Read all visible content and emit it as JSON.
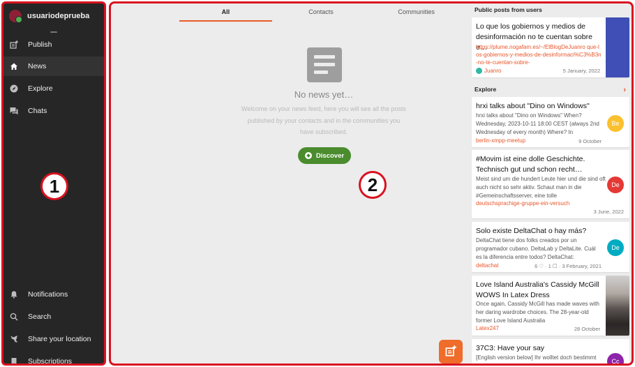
{
  "sidebar": {
    "username": "usuariodeprueba",
    "items": [
      {
        "label": "Publish",
        "icon": "publish-icon"
      },
      {
        "label": "News",
        "icon": "home-icon"
      },
      {
        "label": "Explore",
        "icon": "compass-icon"
      },
      {
        "label": "Chats",
        "icon": "chat-icon"
      }
    ],
    "bottom": [
      {
        "label": "Notifications",
        "icon": "bell-icon"
      },
      {
        "label": "Search",
        "icon": "search-icon"
      },
      {
        "label": "Share your location",
        "icon": "location-off-icon"
      },
      {
        "label": "Subscriptions",
        "icon": "bookmark-icon"
      }
    ]
  },
  "markers": {
    "one": "1",
    "two": "2"
  },
  "feed": {
    "tabs": [
      "All",
      "Contacts",
      "Communities"
    ],
    "empty_title": "No news yet…",
    "empty_body": "Welcome on your news feed, here you will see all the posts published by your contacts and in the communities you have subscribed.",
    "discover_label": "Discover"
  },
  "public_posts": {
    "title": "Public posts from users",
    "card": {
      "title": "Lo que los gobiernos y medios de desinformación no te cuentan sobre e…",
      "link": "https://plume.nogafam.es/~/ElBlogDeJuanro que-los-gobiernos-y-medios-de-desinformaci%C3%B3n-no-te-cuentan-sobre-",
      "author": "Juanro",
      "date": "5 January, 2022"
    }
  },
  "explore": {
    "title": "Explore",
    "cards": [
      {
        "title": "hrxi talks about \"Dino on Windows\"",
        "body": "hrxi talks about \"Dino on Windows\" When? Wednesday, 2023-10-11 18:00 CEST (always 2nd Wednesday of every month) Where? In",
        "link": "berlin-xmpp-meetup",
        "meta": "9 October",
        "badge": "Be",
        "badge_color": "#fbc02d"
      },
      {
        "title": "#Movim ist eine dolle Geschichte. Technisch gut und schon recht…",
        "body": "Meist sind um die hundert Leute hier und die sind oft auch nicht so sehr aktiv. Schaut man in die #Gemeinschaftsserver, eine tolle",
        "link": "deutschsprachige-gruppe-ein-versuch",
        "meta": "3 June, 2022",
        "badge": "De",
        "badge_color": "#e53935"
      },
      {
        "title": "Solo existe DeltaChat o hay más?",
        "body": "DeltaChat tiene dos folks creados por un programador cubano. DeltaLab y DeltaLite. Cuál es la diferencia entre todos? DeltaChat:",
        "link": "deltachat",
        "meta": "6 ♡ · 1 ☐ · 3 February, 2021",
        "badge": "De",
        "badge_color": "#00acc1"
      },
      {
        "title": "Love Island Australia's Cassidy McGill WOWS In Latex Dress",
        "body": "Once again, Cassidy McGill has made waves with her daring wardrobe choices. The 28-year-old former Love Island Australia",
        "link": "Latex247",
        "meta": "28 October"
      },
      {
        "title": "37C3: Have your say",
        "body": "[English version below] Ihr wolltet doch bestimmt schon immer Content-Botschafter",
        "badge": "Cc",
        "badge_color": "#8e24aa"
      }
    ]
  }
}
